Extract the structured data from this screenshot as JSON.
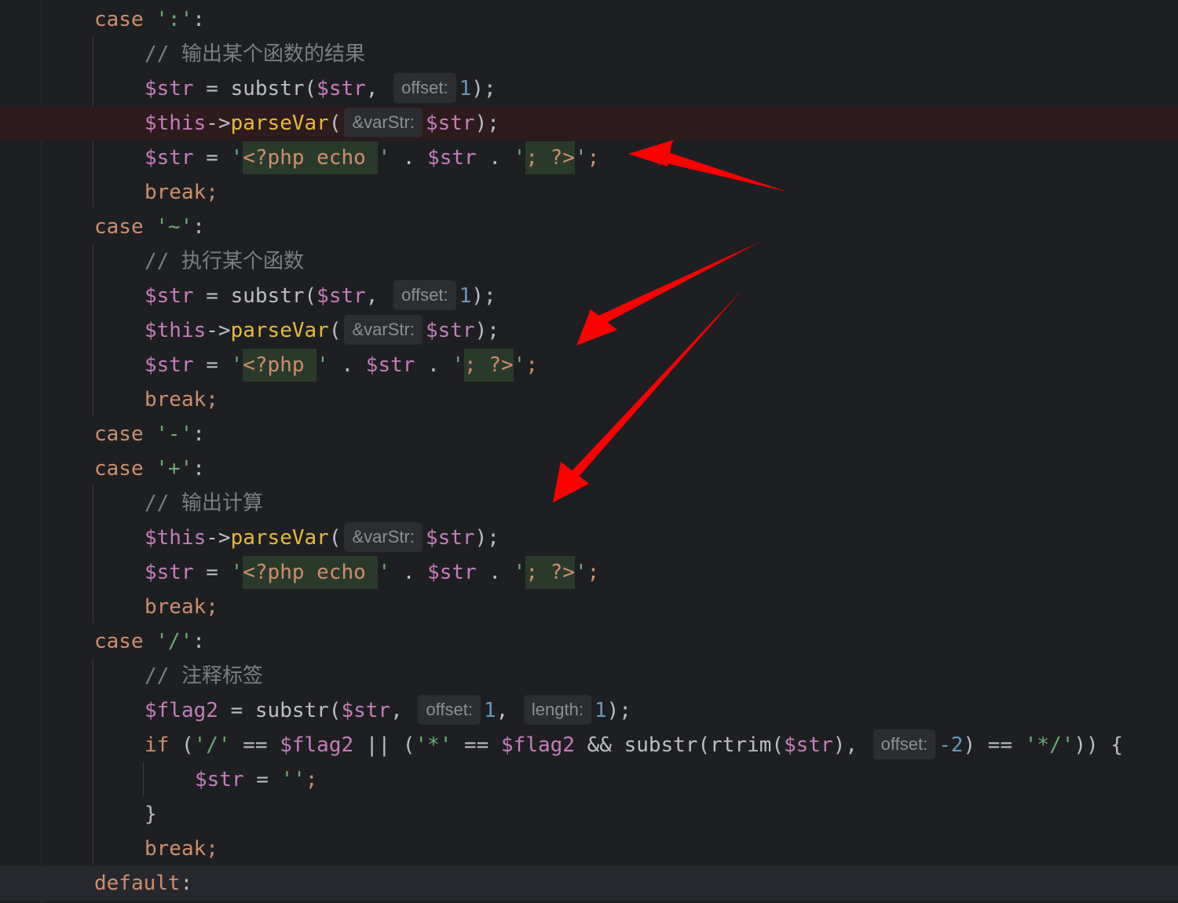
{
  "editor": {
    "language": "PHP",
    "theme_colors": {
      "background": "#1e1f22",
      "keyword": "#cf8e6d",
      "variable": "#c77dbb",
      "string": "#6aab73",
      "number": "#2aacb8",
      "comment": "#7a7e85",
      "error_line": "#2d1b1e",
      "annotation_arrow": "#ff0000"
    },
    "lines": {
      "l1": {
        "kw": "case",
        "str": "':'",
        "colon": ":"
      },
      "l2": {
        "comment": "// 输出某个函数的结果"
      },
      "l3": {
        "v1": "$str",
        "eq": " = ",
        "fn": "substr(",
        "v2": "$str",
        "comma": ",",
        "hint": "offset:",
        "num": "1",
        "end": ");"
      },
      "l4": {
        "v1": "$this",
        "arrow": "->",
        "meth": "parseVar",
        "paren": "(",
        "hint": "&varStr:",
        "v2": "$str",
        "end": ");"
      },
      "l5": {
        "v1": "$str",
        "eq": " = ",
        "q1": "'",
        "s1": "<?php echo ",
        "q2": "'",
        "dot1": " . ",
        "v2": "$str",
        "dot2": " . ",
        "q3": "'",
        "s2": "; ?>",
        "q4": "'",
        "end": ";"
      },
      "l6": {
        "kw": "break",
        "end": ";"
      },
      "l7": {
        "kw": "case",
        "str": "'~'",
        "colon": ":"
      },
      "l8": {
        "comment": "// 执行某个函数"
      },
      "l9": {
        "v1": "$str",
        "eq": " = ",
        "fn": "substr(",
        "v2": "$str",
        "comma": ",",
        "hint": "offset:",
        "num": "1",
        "end": ");"
      },
      "l10": {
        "v1": "$this",
        "arrow": "->",
        "meth": "parseVar",
        "paren": "(",
        "hint": "&varStr:",
        "v2": "$str",
        "end": ");"
      },
      "l11": {
        "v1": "$str",
        "eq": " = ",
        "q1": "'",
        "s1": "<?php ",
        "q2": "'",
        "dot1": " . ",
        "v2": "$str",
        "dot2": " . ",
        "q3": "'",
        "s2": "; ?>",
        "q4": "'",
        "end": ";"
      },
      "l12": {
        "kw": "break",
        "end": ";"
      },
      "l13": {
        "kw": "case",
        "str": "'-'",
        "colon": ":"
      },
      "l14": {
        "kw": "case",
        "str": "'+'",
        "colon": ":"
      },
      "l15": {
        "comment": "// 输出计算"
      },
      "l16": {
        "v1": "$this",
        "arrow": "->",
        "meth": "parseVar",
        "paren": "(",
        "hint": "&varStr:",
        "v2": "$str",
        "end": ");"
      },
      "l17": {
        "v1": "$str",
        "eq": " = ",
        "q1": "'",
        "s1": "<?php echo ",
        "q2": "'",
        "dot1": " . ",
        "v2": "$str",
        "dot2": " . ",
        "q3": "'",
        "s2": "; ?>",
        "q4": "'",
        "end": ";"
      },
      "l18": {
        "kw": "break",
        "end": ";"
      },
      "l19": {
        "kw": "case",
        "str": "'/'",
        "colon": ":"
      },
      "l20": {
        "comment": "// 注释标签"
      },
      "l21": {
        "v1": "$flag2",
        "eq": " = ",
        "fn": "substr(",
        "v2": "$str",
        "comma": ",",
        "hint1": "offset:",
        "num1": "1",
        "comma2": ",",
        "hint2": "length:",
        "num2": "1",
        "end": ");"
      },
      "l22": {
        "kw": "if",
        "p1": " (",
        "s1": "'/'",
        "eq1": " == ",
        "v1": "$flag2",
        "or": " || ",
        "p2": "(",
        "s2": "'*'",
        "eq2": " == ",
        "v2": "$flag2",
        "and": " && ",
        "fn": "substr(rtrim(",
        "v3": "$str",
        "p3": "),",
        "hint": "offset:",
        "num": "-2",
        "p4": ")",
        "eq3": " == ",
        "s3": "'*/'",
        "end": ")) {"
      },
      "l23": {
        "v1": "$str",
        "eq": " = ",
        "s1": "''",
        "end": ";"
      },
      "l24": {
        "brace": "}"
      },
      "l25": {
        "kw": "break",
        "end": ";"
      },
      "l26": {
        "kw": "default",
        "end": ":"
      }
    }
  }
}
